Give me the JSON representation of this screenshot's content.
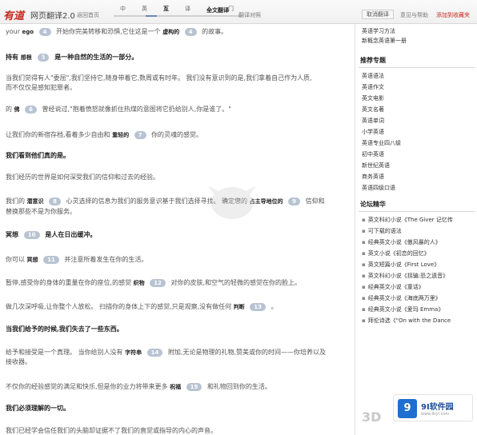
{
  "header": {
    "logo": "有道",
    "title": "网页翻译2.0",
    "home_link": "返回首页",
    "mode_tabs": [
      "中",
      "英",
      "互",
      "译",
      "入",
      "门"
    ],
    "full_translation": "全文翻译",
    "source_compare": "翻译对照",
    "cancel_button": "取消翻译",
    "help_link": "意见与帮助",
    "add_link": "添加到收藏夹"
  },
  "main": {
    "lines": [
      {
        "pre": "your",
        "term": "ego",
        "num": "4",
        "mid": "开始你完美转移和恐惧,它住这是一个",
        "term2": "虚构的",
        "num2": "4",
        "post": "的故事。"
      },
      {
        "bold": true,
        "pre": "持有",
        "term": "想根",
        "num": "5",
        "post": "是一种自然的生活的一部分。"
      },
      {
        "text": "当我们觉得有人\"委屈\",我们坚持它,随身带着它,数周或有时年。 我们没有意识到的是,我们拿着自己作为人质,"
      },
      {
        "text": "而不仅仅是感知犯罪者。"
      },
      {
        "pre": "的",
        "term": "佛",
        "num": "6",
        "post": "曾经说过,\"抱着愤怒就像抓住热煤的意图将它扔给别人,你是谁了。\""
      },
      {
        "pre": "让我们你的新宿存档,看着多少自由和",
        "term": "重轻的",
        "num": "7",
        "post": "你的灵魂的感觉。"
      },
      {
        "bold": true,
        "text": "我们看到他们真的是。"
      },
      {
        "text": "我们经历的世界是如何深受我们的信仰和过去的经验。"
      },
      {
        "pre": "我们的",
        "term": "潜意识",
        "num": "8",
        "mid": "心灵选择的信息为我们的服务意识基于我们选择寻找。 确定您的",
        "term2": "占主导地位的",
        "num2": "9",
        "post": "信仰和"
      },
      {
        "text": "替换那些不是为你服务。"
      },
      {
        "bold": true,
        "pre": "冥想",
        "num": "10",
        "post": "是人在日出缓冲。"
      },
      {
        "pre": "你可以",
        "term": "冥想",
        "num": "11",
        "post": "并注意所着发生在你的生活。"
      },
      {
        "pre": "暂停,感受你的身体的重量在你的座位,的感觉",
        "term": "织物",
        "num": "12",
        "post": "对你的皮肤,和空气的轻微的感觉在你的脸上。"
      },
      {
        "pre": "做几次深呼吸,让你整个人放松。 扫描你的身体上下的感觉,只是观察,没有做任何",
        "term": "判断",
        "num": "13",
        "post": "。"
      },
      {
        "bold": true,
        "text": "当我们给予的时候,我们失去了一些东西。"
      },
      {
        "pre": "给予和接受是一个真理。 当你给别人没有",
        "term": "字符串",
        "num": "14",
        "post": "附加,无论是物理的礼物,赞美或你的时间——你培养以及"
      },
      {
        "text": "接收器。"
      },
      {
        "pre": "不仅你的经验感觉的满足和快乐,但是你的业力将带来更多",
        "term": "祝福",
        "num": "15",
        "post": "和礼物回到你的生活。"
      },
      {
        "bold": true,
        "text": "我们必须理解的一切。"
      },
      {
        "text": "我们已经学会信任我们的头脑却证据不了我们的直觉或指导的内心的声音。"
      }
    ]
  },
  "sidebar": {
    "top_item": "英语学习方法",
    "top_item2": "新概念英语第一册",
    "recommend_title": "推荐专题",
    "recommend_items": [
      "英语语法",
      "英语作文",
      "英文电影",
      "英文名著",
      "英语单词",
      "小学英语",
      "英语专业四八级",
      "初中英语",
      "新世纪英语",
      "商务英语",
      "英语四级口语"
    ],
    "forum_title": "论坛精华",
    "forum_items": [
      "英文科幻小说《The Giver 记忆传",
      "可下载的语法",
      "经典英文小说《傲风暴的人》",
      "英文小说《初恋的回忆》",
      "英文短篇小说《First Love》",
      "英文科幻小说《拐骗:恐之遗音》",
      "经典英文小说《童话》",
      "经典英文小说《海底两万里》",
      "经典英文小说《爱玛 Emma》",
      "拜伦诗选《\"On with the Dance"
    ]
  },
  "brand": {
    "watermark": "3D",
    "site_number": "9",
    "site_name": "9I软件园",
    "site_url": "www.9ryl.com"
  }
}
